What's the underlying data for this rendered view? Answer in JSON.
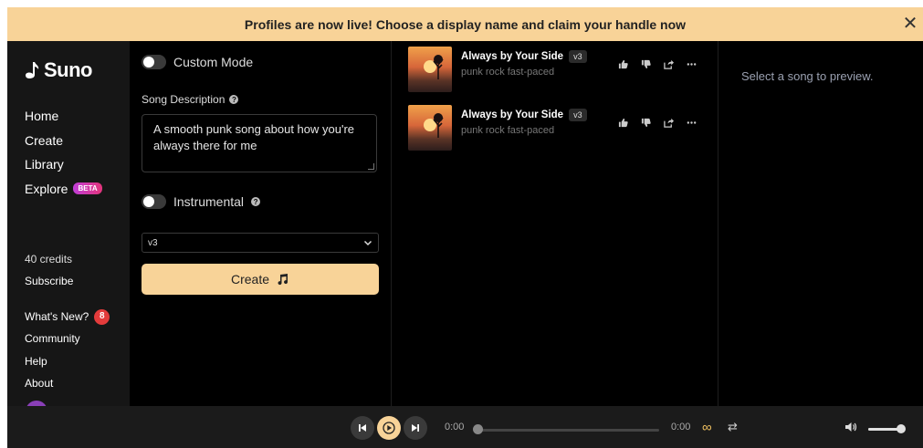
{
  "banner": {
    "text": "Profiles are now live! Choose a display name and claim your handle now",
    "close_glyph": "✕"
  },
  "sidebar": {
    "logo_text": "Suno",
    "nav": [
      {
        "label": "Home"
      },
      {
        "label": "Create"
      },
      {
        "label": "Library"
      },
      {
        "label": "Explore",
        "badge": "BETA"
      }
    ],
    "credits": "40 credits",
    "subscribe": "Subscribe",
    "secondary": [
      {
        "label": "What's New?",
        "count": "8"
      },
      {
        "label": "Community"
      },
      {
        "label": "Help"
      },
      {
        "label": "About"
      }
    ]
  },
  "create": {
    "custom_mode_label": "Custom Mode",
    "song_description_label": "Song Description",
    "song_description_value": "A smooth punk song about how you're always there for me",
    "instrumental_label": "Instrumental",
    "model_selected": "v3",
    "create_button_label": "Create"
  },
  "songs": [
    {
      "title": "Always by Your Side",
      "version": "v3",
      "style": "punk rock fast-paced"
    },
    {
      "title": "Always by Your Side",
      "version": "v3",
      "style": "punk rock fast-paced"
    }
  ],
  "preview": {
    "placeholder": "Select a song to preview."
  },
  "player": {
    "current_time": "0:00",
    "duration": "0:00",
    "progress": 0,
    "volume": 0.9
  },
  "colors": {
    "accent": "#f8d398",
    "badge_red": "#e33b3b"
  }
}
